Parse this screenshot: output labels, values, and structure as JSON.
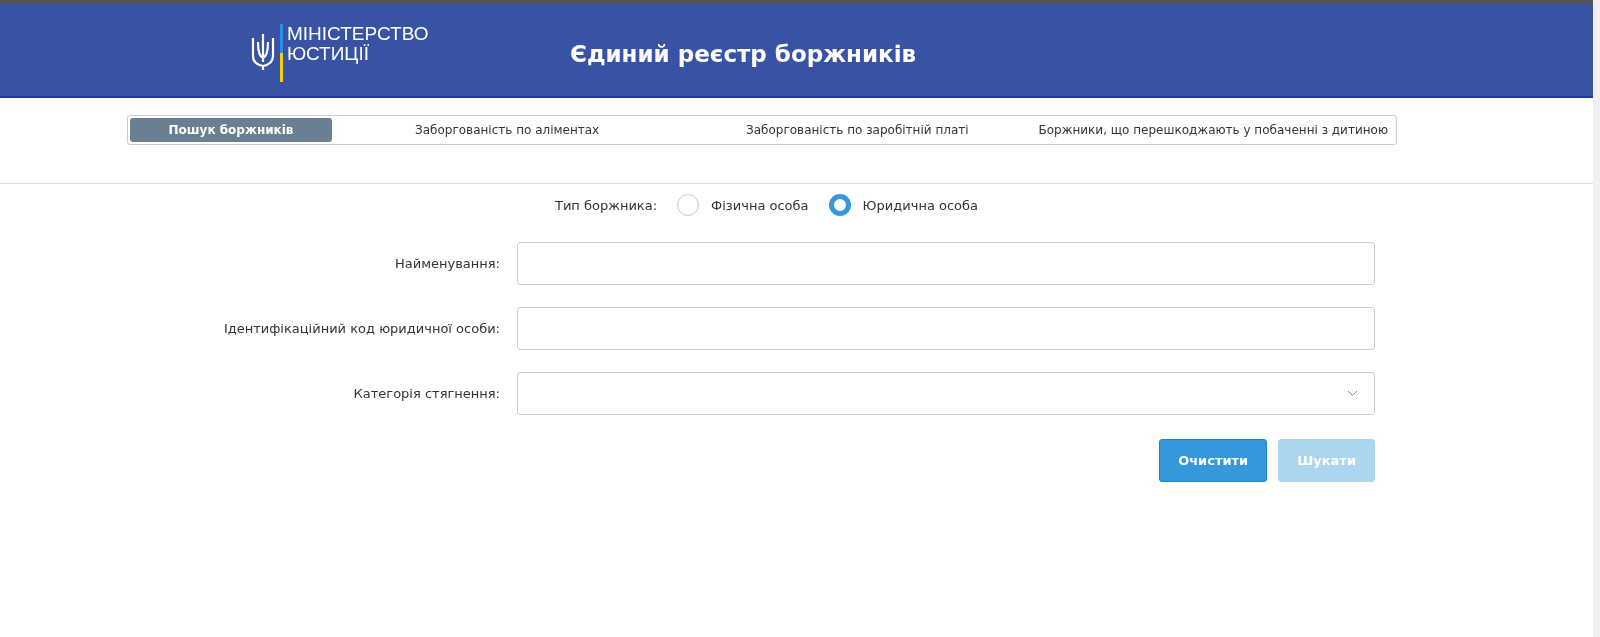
{
  "header": {
    "ministry_line_1": "МІНІСТЕРСТВО",
    "ministry_line_2": "ЮСТИЦІЇ",
    "title": "Єдиний реєстр боржників"
  },
  "tabs": [
    {
      "label": "Пошук боржників",
      "selected": true
    },
    {
      "label": "Заборгованість по аліментах",
      "selected": false
    },
    {
      "label": "Заборгованість по заробітній платі",
      "selected": false
    },
    {
      "label": "Боржники, що перешкоджають у побаченні з дитиною",
      "selected": false
    }
  ],
  "debtor_type": {
    "label": "Тип боржника:",
    "options": [
      {
        "label": "Фізична особа",
        "selected": false
      },
      {
        "label": "Юридична особа",
        "selected": true
      }
    ]
  },
  "fields": [
    {
      "label": "Найменування:",
      "kind": "text"
    },
    {
      "label": "Ідентифікаційний код юридичної особи:",
      "kind": "text"
    },
    {
      "label": "Категорія стягнення:",
      "kind": "select"
    }
  ],
  "buttons": [
    {
      "label": "Очистити",
      "disabled": false
    },
    {
      "label": "Шукати",
      "disabled": true
    }
  ]
}
